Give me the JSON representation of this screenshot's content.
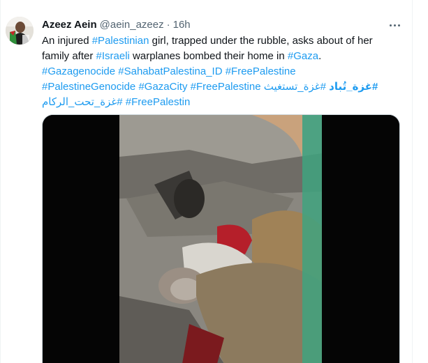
{
  "tweet": {
    "display_name": "Azeez Aein",
    "handle": "@aein_azeez",
    "separator": "·",
    "time": "16h",
    "text_lines": [
      [
        {
          "t": "An injured ",
          "tag": false
        },
        {
          "t": "#Palestinian",
          "tag": true
        },
        {
          "t": " girl, trapped under the rubble, asks about of her",
          "tag": false
        }
      ],
      [
        {
          "t": "family after ",
          "tag": false
        },
        {
          "t": "#Israeli",
          "tag": true
        },
        {
          "t": " warplanes bombed their home in ",
          "tag": false
        },
        {
          "t": "#Gaza",
          "tag": true
        },
        {
          "t": ".",
          "tag": false
        }
      ],
      [
        {
          "t": "#Gazagenocide",
          "tag": true
        },
        {
          "t": " ",
          "tag": false
        },
        {
          "t": "#SahabatPalestina_ID",
          "tag": true
        },
        {
          "t": " ",
          "tag": false
        },
        {
          "t": "#FreePalestine",
          "tag": true
        }
      ],
      [
        {
          "t": "#PalestineGenocide",
          "tag": true
        },
        {
          "t": " ",
          "tag": false
        },
        {
          "t": "#GazaCity",
          "tag": true
        },
        {
          "t": " ",
          "tag": false
        },
        {
          "t": "#FreePalestine",
          "tag": true
        },
        {
          "t": " ",
          "tag": false
        },
        {
          "t": "#غزة_تستغيث",
          "tag": true,
          "rtl": true
        },
        {
          "t": " ",
          "tag": false
        },
        {
          "t": "#غزة_تُباد",
          "tag": true,
          "rtl": true,
          "bold": true
        }
      ],
      [
        {
          "t": "#غزة_تحت_الركام",
          "tag": true,
          "rtl": true
        },
        {
          "t": " ",
          "tag": false
        },
        {
          "t": "#FreePalestin",
          "tag": true
        }
      ]
    ]
  },
  "icons": {
    "more": "more-horizontal-icon"
  },
  "colors": {
    "link": "#1d9bf0",
    "text": "#0f1419",
    "secondary": "#536471"
  }
}
